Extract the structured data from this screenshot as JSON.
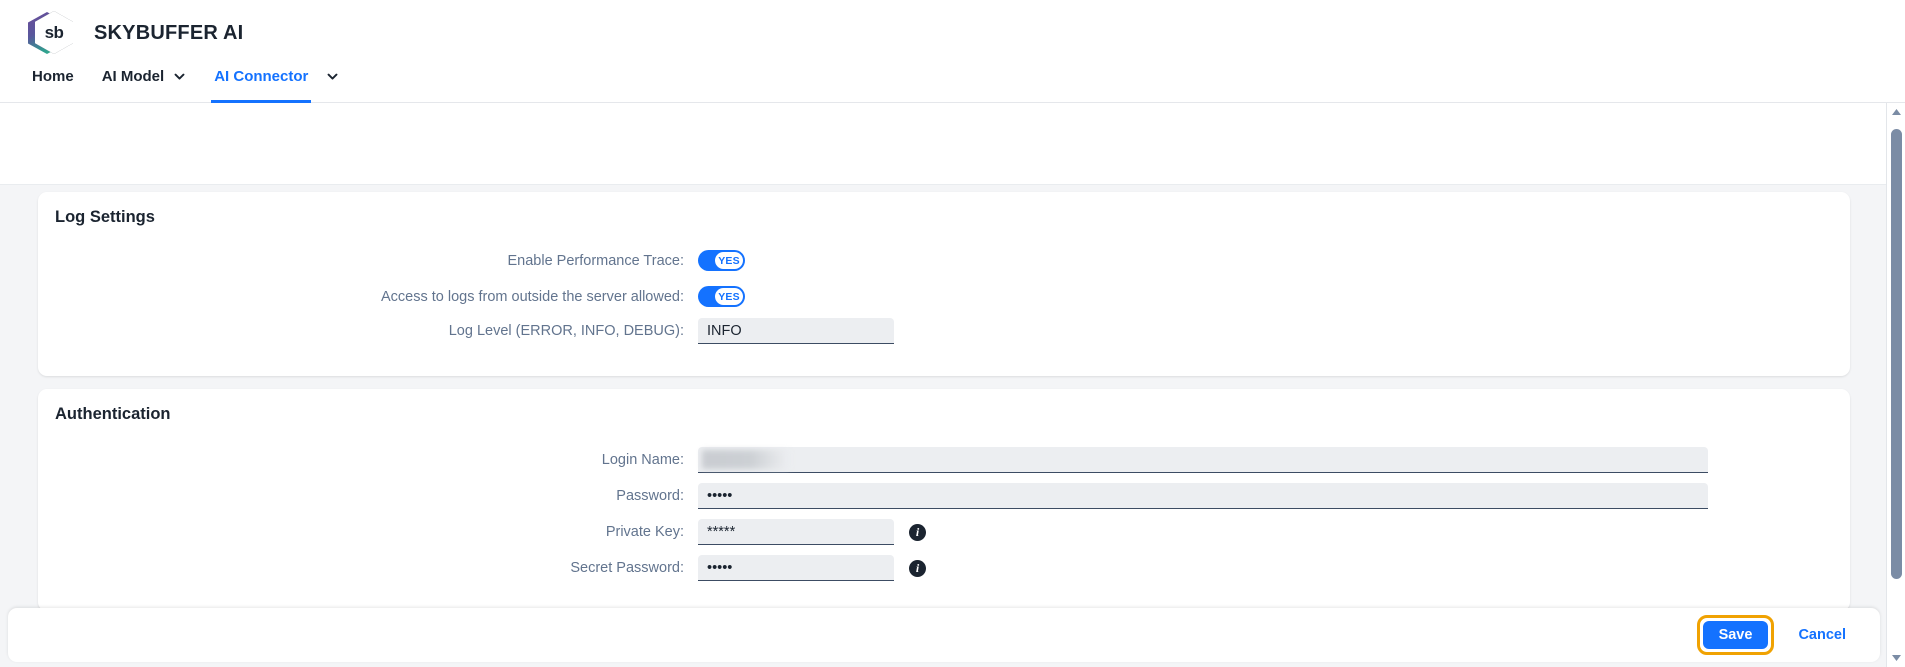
{
  "header": {
    "brand_title": "SKYBUFFER AI",
    "logo_text": "sb",
    "nav": [
      {
        "label": "Home",
        "has_chevron": false,
        "active": false
      },
      {
        "label": "AI Model",
        "has_chevron": true,
        "active": false
      },
      {
        "label": "AI Connector",
        "has_chevron": true,
        "active": true
      }
    ]
  },
  "log_settings": {
    "title": "Log Settings",
    "rows": [
      {
        "label": "Enable Performance Trace:",
        "type": "toggle",
        "value": "YES"
      },
      {
        "label": "Access to logs from outside the server allowed:",
        "type": "toggle",
        "value": "YES"
      },
      {
        "label": "Log Level (ERROR, INFO, DEBUG):",
        "type": "input",
        "value": "INFO"
      }
    ]
  },
  "authentication": {
    "title": "Authentication",
    "rows": [
      {
        "label": "Login Name:",
        "type": "input-masked",
        "value": ""
      },
      {
        "label": "Password:",
        "type": "input",
        "value": "•••••"
      },
      {
        "label": "Private Key:",
        "type": "input",
        "value": "*****",
        "info": "i"
      },
      {
        "label": "Secret Password:",
        "type": "input",
        "value": "•••••",
        "info": "i"
      }
    ]
  },
  "footer": {
    "save_label": "Save",
    "cancel_label": "Cancel"
  },
  "colors": {
    "accent": "#1472ff",
    "focus_ring": "#f0a202",
    "page_bg": "#f4f5f7",
    "label": "#62748e",
    "text": "#1b2430",
    "field_bg": "#eceef1",
    "scrollbar_thumb": "#7b8ca5"
  }
}
